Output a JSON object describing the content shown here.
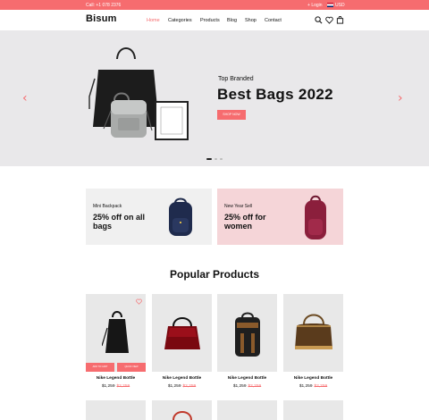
{
  "topbar": {
    "phone": "Call: +1 078 2376",
    "login": "Login",
    "currency": "USD"
  },
  "header": {
    "logo": "Bisum",
    "nav": [
      "Home",
      "Categories",
      "Products",
      "Blog",
      "Shop",
      "Contact"
    ],
    "active_nav": "Home"
  },
  "hero": {
    "subtitle": "Top Branded",
    "title": "Best Bags 2022",
    "button": "SHOP NOW",
    "slides_total": 3,
    "slide_active": 1
  },
  "promos": [
    {
      "label": "Mini Backpack",
      "headline": "25% off on all bags"
    },
    {
      "label": "New Year Sell",
      "headline": "25% off for women"
    }
  ],
  "section": {
    "title": "Popular Products"
  },
  "products": [
    {
      "name": "Nike Legend Bottle",
      "price": "$1,259",
      "old_price": "$2,259",
      "action_1": "ADD TO CART",
      "action_2": "QUICK VIEW"
    },
    {
      "name": "Nike Legend Bottle",
      "price": "$1,259",
      "old_price": "$2,259"
    },
    {
      "name": "Nike Legend Bottle",
      "price": "$1,259",
      "old_price": "$2,259"
    },
    {
      "name": "Nike Legend Bottle",
      "price": "$1,259",
      "old_price": "$2,259"
    }
  ],
  "colors": {
    "accent": "#f66c6f",
    "hero_bg": "#e9e8ea",
    "promo_grey": "#f0f0f0",
    "promo_pink": "#f5d5d8"
  }
}
